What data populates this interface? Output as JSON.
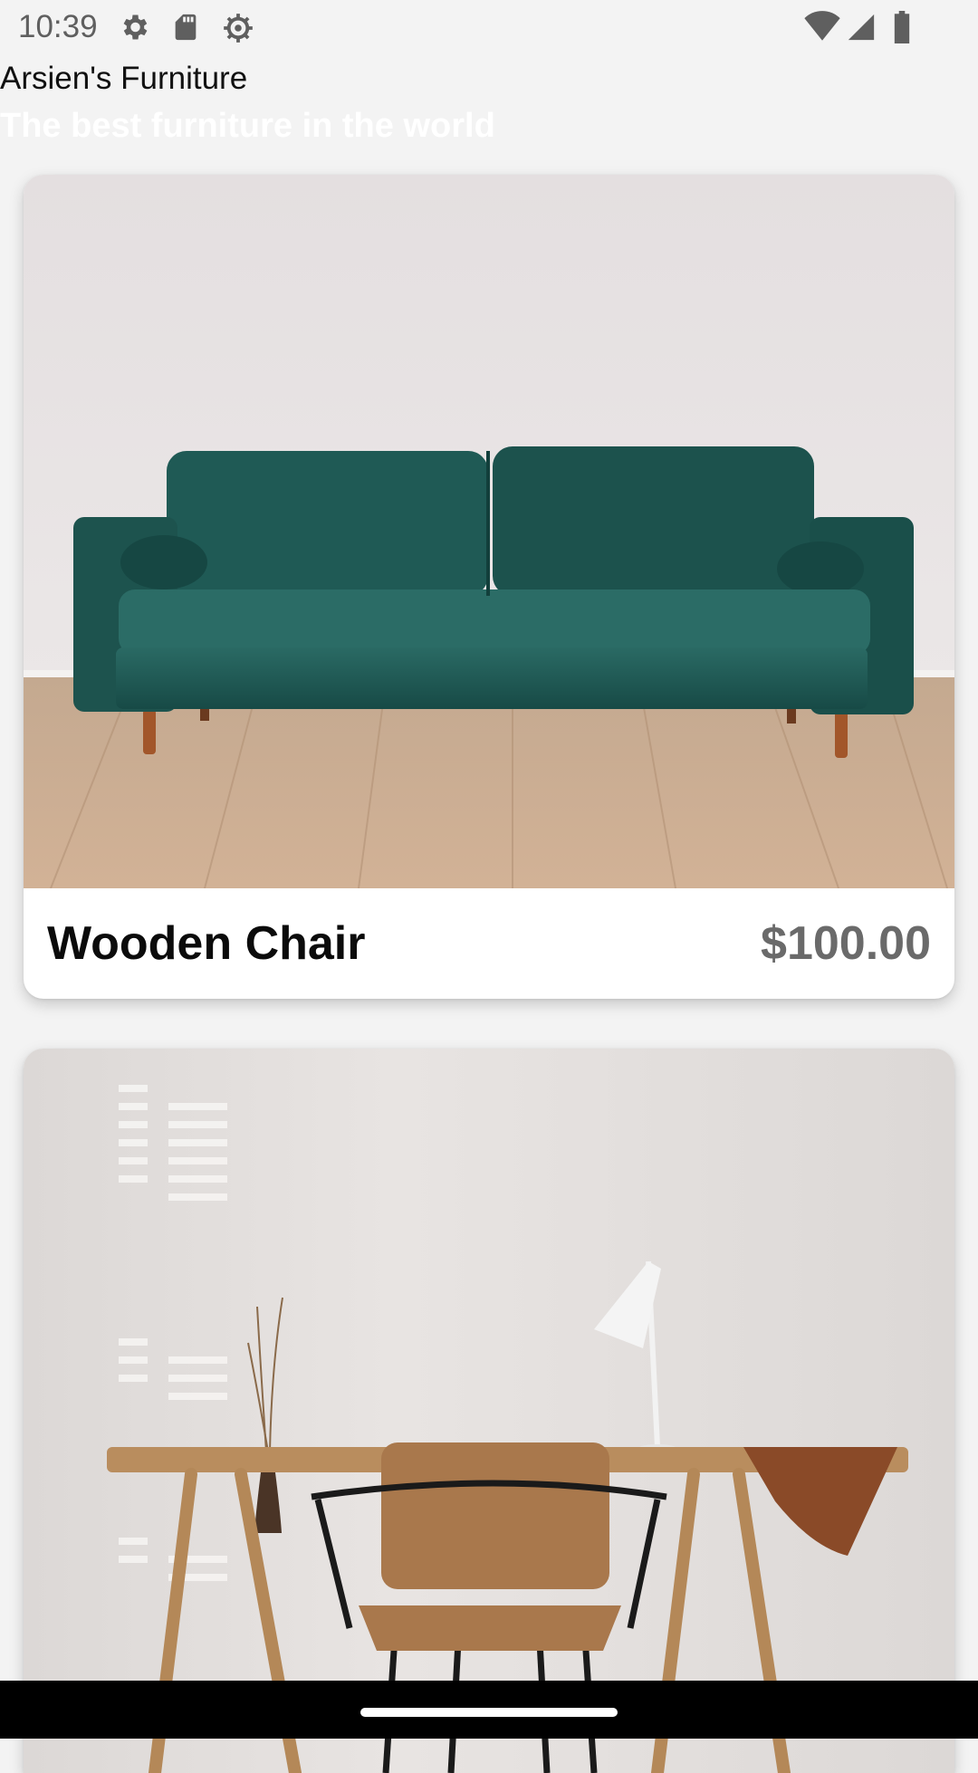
{
  "status_bar": {
    "time": "10:39",
    "left_icons": [
      "gear-icon",
      "sd-card-icon",
      "debug-icon"
    ],
    "right_icons": [
      "wifi-icon",
      "signal-icon",
      "battery-icon"
    ]
  },
  "header": {
    "title": "Arsien's Furniture",
    "subtitle": "The best furniture in the world"
  },
  "products": [
    {
      "name": "Wooden Chair",
      "price": "$100.00",
      "image": "green-velvet-sofa-photo"
    },
    {
      "image": "wooden-desk-and-chair-photo"
    }
  ],
  "colors": {
    "background": "#f3f3f3",
    "card": "#ffffff",
    "price": "#6a6a6a",
    "subtitle": "#ffffff",
    "sofa": "#1f5a55",
    "wood": "#b98d5e"
  }
}
